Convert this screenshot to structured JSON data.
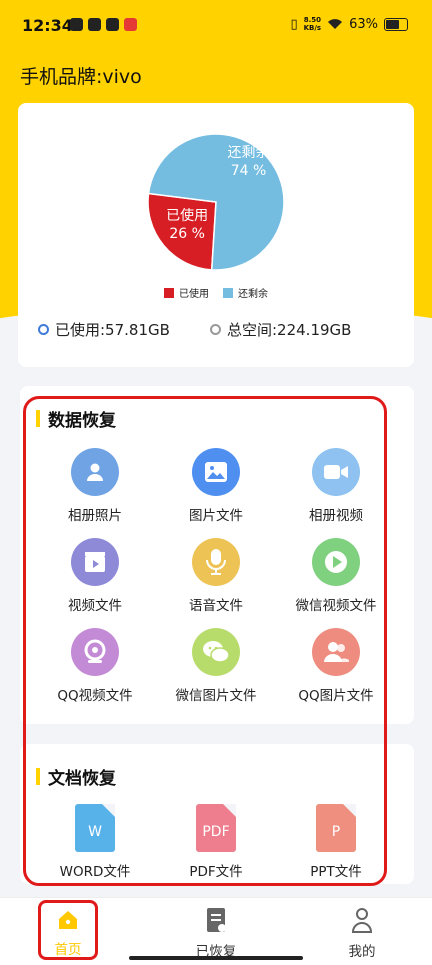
{
  "status_bar": {
    "time": "12:34",
    "speed_value": "8.50",
    "speed_unit": "KB/s",
    "battery": "63%"
  },
  "header": {
    "title": "手机品牌:vivo"
  },
  "storage": {
    "used_label": "已使用:57.81GB",
    "total_label": "总空间:224.19GB"
  },
  "chart_data": {
    "type": "pie",
    "slices": [
      {
        "name": "已使用",
        "value": 26,
        "label": "26 %",
        "color": "#d81e25"
      },
      {
        "name": "还剩余",
        "value": 74,
        "label": "74 %",
        "color": "#74bde1"
      }
    ],
    "legend": [
      "已使用",
      "还剩余"
    ],
    "legend_position": "bottom"
  },
  "data_recovery": {
    "title": "数据恢复",
    "items": [
      {
        "label": "相册照片",
        "icon": "person-photo-icon",
        "color": "#6fa3e3"
      },
      {
        "label": "图片文件",
        "icon": "image-icon",
        "color": "#4e8ff0"
      },
      {
        "label": "相册视频",
        "icon": "video-camera-icon",
        "color": "#8fc2f0"
      },
      {
        "label": "视频文件",
        "icon": "film-clapper-icon",
        "color": "#8e8ad8"
      },
      {
        "label": "语音文件",
        "icon": "microphone-icon",
        "color": "#eec355"
      },
      {
        "label": "微信视频文件",
        "icon": "play-icon",
        "color": "#7fd07f"
      },
      {
        "label": "QQ视频文件",
        "icon": "webcam-icon",
        "color": "#c38ad5"
      },
      {
        "label": "微信图片文件",
        "icon": "wechat-icon",
        "color": "#b8dc6b"
      },
      {
        "label": "QQ图片文件",
        "icon": "users-icon",
        "color": "#ee8c7f"
      }
    ]
  },
  "doc_recovery": {
    "title": "文档恢复",
    "items": [
      {
        "label": "WORD文件",
        "glyph": "W",
        "color": "#58b2ea"
      },
      {
        "label": "PDF文件",
        "glyph": "PDF",
        "color": "#ee7e8e"
      },
      {
        "label": "PPT文件",
        "glyph": "P",
        "color": "#ee8f80"
      }
    ]
  },
  "nav": {
    "items": [
      {
        "label": "首页",
        "active": true
      },
      {
        "label": "已恢复",
        "active": false
      },
      {
        "label": "我的",
        "active": false
      }
    ],
    "active_color": "#ffc800",
    "inactive_color": "#333333"
  }
}
